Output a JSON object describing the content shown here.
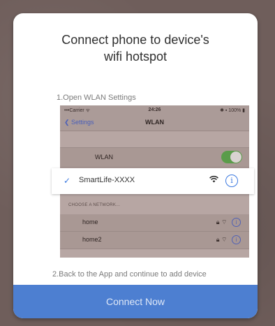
{
  "dialog": {
    "title": "Connect phone to device's\nwifi hotspot",
    "step1": "1.Open WLAN Settings",
    "step2": "2.Back to the App and continue to add device",
    "connect_label": "Connect Now"
  },
  "screenshot": {
    "status": {
      "carrier": "•••Carrier ᯤ",
      "time": "24:26",
      "battery": "✱ ▪ 100% ▮"
    },
    "nav": {
      "back_label": "❮ Settings",
      "title": "WLAN"
    },
    "wlan_label": "WLAN",
    "wlan_enabled": true,
    "section_header": "CHOOSE A NETWORK...",
    "selected_network": "SmartLife-XXXX",
    "networks": [
      {
        "name": "home"
      },
      {
        "name": "home2"
      }
    ]
  },
  "icons": {
    "check": "check-icon",
    "wifi": "wifi-icon",
    "info": "info-icon",
    "lock": "lock-icon"
  },
  "colors": {
    "accent": "#3a78e0",
    "button": "#4d7fd1"
  }
}
